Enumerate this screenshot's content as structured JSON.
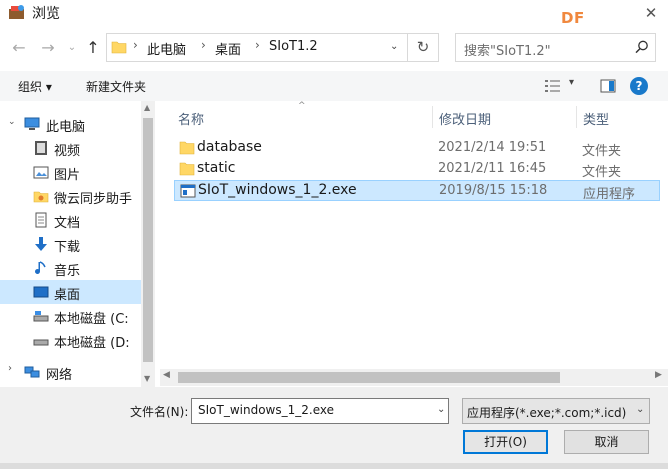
{
  "window": {
    "title": "浏览",
    "watermark": "DF"
  },
  "nav": {
    "breadcrumb": [
      "此电脑",
      "桌面",
      "SIoT1.2"
    ],
    "search_placeholder": "搜索\"SIoT1.2\""
  },
  "toolbar": {
    "organize": "组织 ▾",
    "new_folder": "新建文件夹"
  },
  "sidebar": {
    "items": [
      {
        "label": "此电脑",
        "icon": "computer-icon"
      },
      {
        "label": "视频",
        "icon": "video-icon"
      },
      {
        "label": "图片",
        "icon": "pictures-icon"
      },
      {
        "label": "微云同步助手",
        "icon": "weiyun-icon"
      },
      {
        "label": "文档",
        "icon": "documents-icon"
      },
      {
        "label": "下载",
        "icon": "download-icon"
      },
      {
        "label": "音乐",
        "icon": "music-icon"
      },
      {
        "label": "桌面",
        "icon": "desktop-icon",
        "selected": true
      },
      {
        "label": "本地磁盘 (C:",
        "icon": "drive-icon"
      },
      {
        "label": "本地磁盘 (D:",
        "icon": "drive-icon"
      },
      {
        "label": "网络",
        "icon": "network-icon"
      }
    ]
  },
  "columns": {
    "name": "名称",
    "date": "修改日期",
    "type": "类型"
  },
  "files": [
    {
      "name": "database",
      "date": "2021/2/14 19:51",
      "type": "文件夹",
      "icon": "folder-icon"
    },
    {
      "name": "static",
      "date": "2021/2/11 16:45",
      "type": "文件夹",
      "icon": "folder-icon"
    },
    {
      "name": "SIoT_windows_1_2.exe",
      "date": "2019/8/15 15:18",
      "type": "应用程序",
      "icon": "exe-icon",
      "selected": true
    }
  ],
  "footer": {
    "filename_label": "文件名(N):",
    "filename_value": "SIoT_windows_1_2.exe",
    "filetype_value": "应用程序(*.exe;*.com;*.icd)",
    "open_label": "打开(O)",
    "cancel_label": "取消"
  },
  "colors": {
    "selection": "#cce8ff",
    "accent": "#0078d7",
    "watermark": "#f0883e"
  }
}
